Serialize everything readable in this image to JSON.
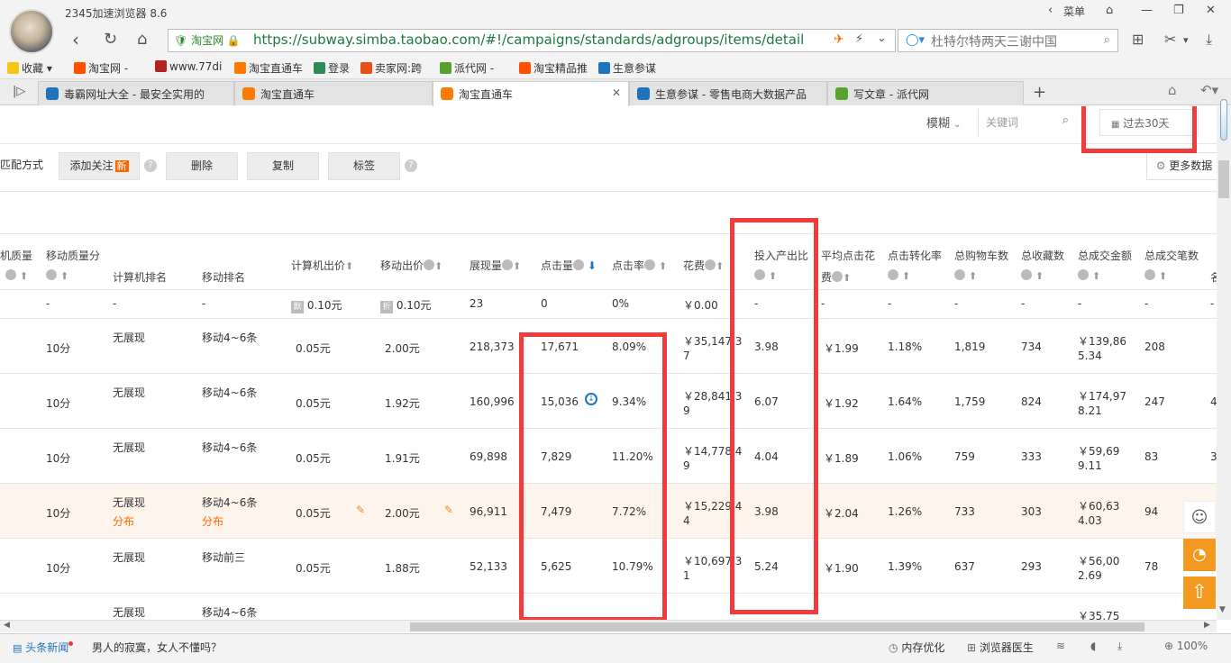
{
  "window": {
    "title": "2345加速浏览器 8.6",
    "menu_label": "菜单"
  },
  "address": {
    "secure_label": "淘宝网",
    "url": "https://subway.simba.taobao.com/#!/campaigns/standards/adgroups/items/detail?tab=",
    "search_text": "杜特尔特两天三谢中国"
  },
  "bookmarks": [
    {
      "label": "收藏",
      "color": "#f5a623"
    },
    {
      "label": "淘宝网 -",
      "color": "#ff5000"
    },
    {
      "label": "www.77di",
      "color": "#b22222"
    },
    {
      "label": "淘宝直通车",
      "color": "#ff7a00"
    },
    {
      "label": "登录",
      "color": "#2e8b57"
    },
    {
      "label": "卖家网:跨",
      "color": "#e8501a"
    },
    {
      "label": "派代网 -",
      "color": "#5aa02c"
    },
    {
      "label": "淘宝精品推",
      "color": "#ff5000"
    },
    {
      "label": "生意参谋",
      "color": "#1e73be"
    }
  ],
  "tabs": [
    {
      "label": "毒霸网址大全 - 最安全实用的",
      "color": "#1e73be"
    },
    {
      "label": "淘宝直通车",
      "color": "#ff7a00"
    },
    {
      "label": "淘宝直通车",
      "color": "#ff7a00"
    },
    {
      "label": "生意参谋 - 零售电商大数据产品",
      "color": "#1e73be"
    },
    {
      "label": "写文章 - 派代网",
      "color": "#5aa02c"
    }
  ],
  "filters": {
    "match_label": "模糊",
    "keyword_placeholder": "关键词",
    "date_label": "过去30天"
  },
  "actions": {
    "match_method": "匹配方式",
    "follow": "添加关注",
    "new_badge": "新",
    "delete": "删除",
    "copy": "复制",
    "tag": "标签",
    "more_data": "更多数据"
  },
  "headers": {
    "pc_quality": "机质量",
    "mobile_quality": "移动质量分",
    "pc_rank": "计算机排名",
    "mobile_rank": "移动排名",
    "pc_bid": "计算机出价",
    "mobile_bid": "移动出价",
    "impressions": "展现量",
    "clicks": "点击量",
    "ctr": "点击率",
    "cost": "花费",
    "roi": "投入产出比",
    "avg_cpc_1": "平均点击花",
    "avg_cpc_2": "费",
    "cvr": "点击转化率",
    "carts": "总购物车数",
    "favs": "总收藏数",
    "gmv": "总成交金额",
    "orders": "总成交笔数",
    "extra": "名"
  },
  "summary": {
    "pc_quality": "-",
    "mobile_quality": "-",
    "pc_rank": "-",
    "mobile_rank": "-",
    "pc_bid": "0.10元",
    "mobile_bid": "0.10元",
    "impressions": "23",
    "clicks": "0",
    "ctr": "0%",
    "cost": "￥0.00",
    "roi": "-",
    "avg_cpc": "-",
    "cvr": "-",
    "carts": "-",
    "favs": "-",
    "gmv": "-",
    "orders": "-",
    "extra": "-"
  },
  "rows": [
    {
      "quality": "10分",
      "pc_rank": "无展现",
      "mobile_rank": "移动4~6条",
      "pc_bid": "0.05元",
      "mobile_bid": "2.00元",
      "impressions": "218,373",
      "clicks": "17,671",
      "ctr": "8.09%",
      "cost1": "￥35,147.3",
      "cost2": "7",
      "roi": "3.98",
      "avg_cpc": "￥1.99",
      "cvr": "1.18%",
      "carts": "1,819",
      "favs": "734",
      "gmv1": "￥139,86",
      "gmv2": "5.34",
      "orders": "208",
      "extra": ""
    },
    {
      "quality": "10分",
      "pc_rank": "无展现",
      "mobile_rank": "移动4~6条",
      "pc_bid": "0.05元",
      "mobile_bid": "1.92元",
      "impressions": "160,996",
      "clicks": "15,036",
      "ctr": "9.34%",
      "cost1": "￥28,841.3",
      "cost2": "9",
      "roi": "6.07",
      "avg_cpc": "￥1.92",
      "cvr": "1.64%",
      "carts": "1,759",
      "favs": "824",
      "gmv1": "￥174,97",
      "gmv2": "8.21",
      "orders": "247",
      "extra": "4"
    },
    {
      "quality": "10分",
      "pc_rank": "无展现",
      "mobile_rank": "移动4~6条",
      "pc_bid": "0.05元",
      "mobile_bid": "1.91元",
      "impressions": "69,898",
      "clicks": "7,829",
      "ctr": "11.20%",
      "cost1": "￥14,778.4",
      "cost2": "9",
      "roi": "4.04",
      "avg_cpc": "￥1.89",
      "cvr": "1.06%",
      "carts": "759",
      "favs": "333",
      "gmv1": "￥59,69",
      "gmv2": "9.11",
      "orders": "83",
      "extra": "3"
    },
    {
      "quality": "10分",
      "pc_rank": "无展现",
      "mobile_rank": "移动4~6条",
      "pc_bid": "0.05元",
      "mobile_bid": "2.00元",
      "impressions": "96,911",
      "clicks": "7,479",
      "ctr": "7.72%",
      "cost1": "￥15,229.4",
      "cost2": "4",
      "roi": "3.98",
      "avg_cpc": "￥2.04",
      "cvr": "1.26%",
      "carts": "733",
      "favs": "303",
      "gmv1": "￥60,63",
      "gmv2": "4.03",
      "orders": "94",
      "extra": "",
      "pc_sub": "分布",
      "mobile_sub": "分布"
    },
    {
      "quality": "10分",
      "pc_rank": "无展现",
      "mobile_rank": "移动前三",
      "pc_bid": "0.05元",
      "mobile_bid": "1.88元",
      "impressions": "52,133",
      "clicks": "5,625",
      "ctr": "10.79%",
      "cost1": "￥10,697.3",
      "cost2": "1",
      "roi": "5.24",
      "avg_cpc": "￥1.90",
      "cvr": "1.39%",
      "carts": "637",
      "favs": "293",
      "gmv1": "￥56,00",
      "gmv2": "2.69",
      "orders": "78",
      "extra": ""
    },
    {
      "quality": "",
      "pc_rank": "无展现",
      "mobile_rank": "移动4~6条",
      "pc_bid": "",
      "mobile_bid": "",
      "impressions": "",
      "clicks": "",
      "ctr": "",
      "cost1": "",
      "cost2": "",
      "roi": "",
      "avg_cpc": "",
      "cvr": "",
      "carts": "",
      "favs": "",
      "gmv1": "￥35,75",
      "gmv2": "",
      "orders": "",
      "extra": ""
    }
  ],
  "status": {
    "news_label": "头条新闻",
    "headline": "男人的寂寞，女人不懂吗？",
    "memory": "内存优化",
    "doctor": "浏览器医生",
    "zoom": "100%"
  }
}
